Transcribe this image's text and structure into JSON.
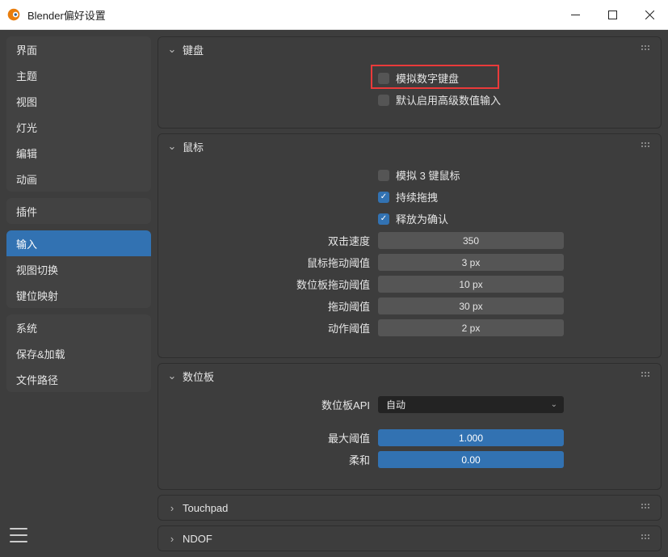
{
  "window": {
    "title": "Blender偏好设置"
  },
  "sidebar": {
    "groups": [
      [
        "界面",
        "主题",
        "视图",
        "灯光",
        "编辑",
        "动画"
      ],
      [
        "插件"
      ],
      [
        "输入",
        "视图切换",
        "键位映射"
      ],
      [
        "系统",
        "保存&加载",
        "文件路径"
      ]
    ],
    "active": "输入"
  },
  "panels": {
    "keyboard": {
      "title": "键盘",
      "expanded": true,
      "cb_emulate": {
        "label": "模拟数字键盘",
        "checked": false,
        "highlight": true
      },
      "cb_advnum": {
        "label": "默认启用高级数值输入",
        "checked": false
      }
    },
    "mouse": {
      "title": "鼠标",
      "expanded": true,
      "cb_emu3": {
        "label": "模拟 3 键鼠标",
        "checked": false
      },
      "cb_contdrag": {
        "label": "持续拖拽",
        "checked": true
      },
      "cb_release": {
        "label": "释放为确认",
        "checked": true
      },
      "dblclick": {
        "label": "双击速度",
        "value": "350"
      },
      "mousedrag": {
        "label": "鼠标拖动阈值",
        "value": "3 px"
      },
      "tabletdrag": {
        "label": "数位板拖动阈值",
        "value": "10 px"
      },
      "dragthresh": {
        "label": "拖动阈值",
        "value": "30 px"
      },
      "motionthresh": {
        "label": "动作阈值",
        "value": "2 px"
      }
    },
    "tablet": {
      "title": "数位板",
      "expanded": true,
      "api": {
        "label": "数位板API",
        "value": "自动"
      },
      "maxthresh": {
        "label": "最大阈值",
        "value": "1.000"
      },
      "soft": {
        "label": "柔和",
        "value": "0.00"
      }
    },
    "touchpad": {
      "title": "Touchpad",
      "expanded": false
    },
    "ndof": {
      "title": "NDOF",
      "expanded": false
    }
  }
}
